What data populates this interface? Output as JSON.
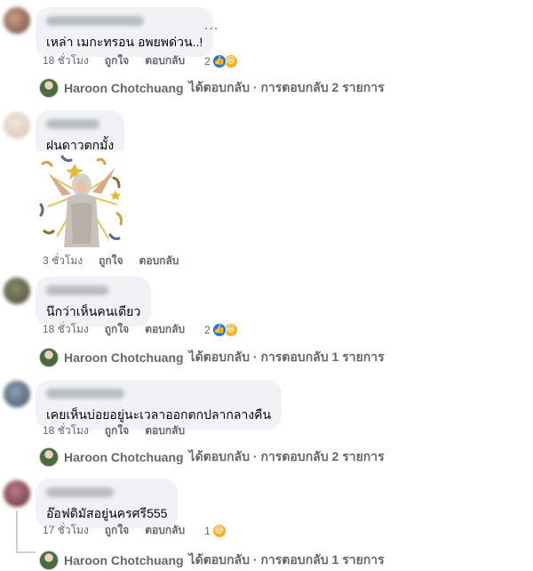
{
  "comments": [
    {
      "text": "เหล่า เมกะทรอน อพยพด่วน..!",
      "time": "18 ชั่วโมง",
      "like_label": "ถูกใจ",
      "reply_label": "ตอบกลับ",
      "reaction_count": "2",
      "reactions": [
        "like-icon",
        "haha-icon"
      ],
      "more_label": "...",
      "replies": {
        "author": "Haroon Chotchuang",
        "summary": "ได้ตอบกลับ · การตอบกลับ 2 รายการ"
      }
    },
    {
      "text": "ฝนดาวตกมั้ง",
      "time": "3 ชั่วโมง",
      "like_label": "ถูกใจ",
      "reply_label": "ตอบกลับ",
      "sticker": "celebration-sticker"
    },
    {
      "text": "นึกว่าเห็นคนเดียว",
      "time": "18 ชั่วโมง",
      "like_label": "ถูกใจ",
      "reply_label": "ตอบกลับ",
      "reaction_count": "2",
      "reactions": [
        "like-icon",
        "haha-icon"
      ],
      "replies": {
        "author": "Haroon Chotchuang",
        "summary": "ได้ตอบกลับ · การตอบกลับ 1 รายการ"
      }
    },
    {
      "text": "เคยเห็นบ่อยอยู่นะเวลาออกตกปลากลางคืน",
      "time": "18 ชั่วโมง",
      "like_label": "ถูกใจ",
      "reply_label": "ตอบกลับ",
      "replies": {
        "author": "Haroon Chotchuang",
        "summary": "ได้ตอบกลับ · การตอบกลับ 2 รายการ"
      }
    },
    {
      "text": "อ๊อฟดิมัสอยู่นครศรี555",
      "time": "17 ชั่วโมง",
      "like_label": "ถูกใจ",
      "reply_label": "ตอบกลับ",
      "reaction_count": "1",
      "reactions": [
        "haha-icon"
      ],
      "replies": {
        "author": "Haroon Chotchuang",
        "summary": "ได้ตอบกลับ · การตอบกลับ 1 รายการ"
      }
    }
  ],
  "colors": {
    "bubble_bg": "#f0f2f5",
    "meta_text": "#65676b",
    "like_blue": "#1877f2",
    "haha_yellow": "#f7b125"
  }
}
